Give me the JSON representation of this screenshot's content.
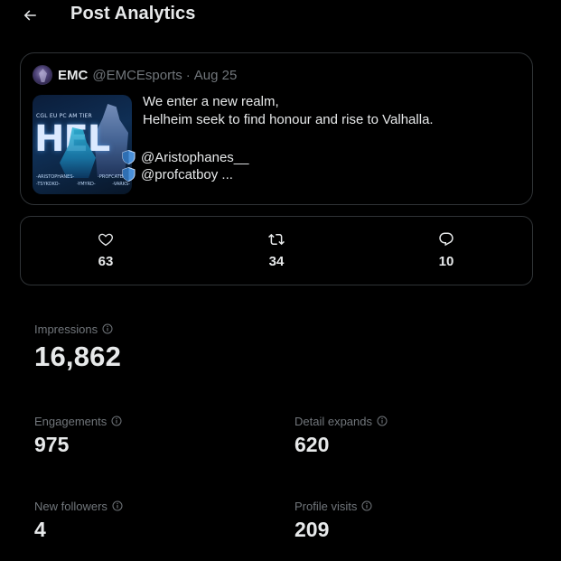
{
  "header": {
    "back_icon": "arrow-left-icon",
    "title": "Post Analytics"
  },
  "post": {
    "author_name": "EMC",
    "author_handle": "@EMCEsports",
    "separator": "·",
    "date": "Aug 25",
    "media": {
      "top_text": "CGL EU PC AM TIER",
      "big_text": "HEL",
      "names_row1": [
        "-ARISTOPHANES-",
        "-PROFCATBOY-"
      ],
      "names_row2": [
        "-TSYKOKO-",
        "-YMYRD-",
        "-VARKS-"
      ]
    },
    "text_lines": [
      "We enter a new realm,",
      "Helheim seek to find honour and rise to Valhalla."
    ],
    "mentions": [
      {
        "icon": "shield-icon",
        "text": "@Aristophanes__"
      },
      {
        "icon": "shield-icon",
        "text": "@profcatboy ..."
      }
    ]
  },
  "engagement": {
    "likes": {
      "icon": "heart-icon",
      "count": "63"
    },
    "reposts": {
      "icon": "repost-icon",
      "count": "34"
    },
    "replies": {
      "icon": "reply-icon",
      "count": "10"
    }
  },
  "metrics": {
    "impressions": {
      "label": "Impressions",
      "value": "16,862"
    },
    "engagements": {
      "label": "Engagements",
      "value": "975"
    },
    "detail_expands": {
      "label": "Detail expands",
      "value": "620"
    },
    "new_followers": {
      "label": "New followers",
      "value": "4"
    },
    "profile_visits": {
      "label": "Profile visits",
      "value": "209"
    }
  },
  "colors": {
    "background": "#000000",
    "text_primary": "#e7e9ea",
    "text_secondary": "#71767b",
    "border": "#2f3336",
    "shield_blue": "#4a90d9"
  }
}
